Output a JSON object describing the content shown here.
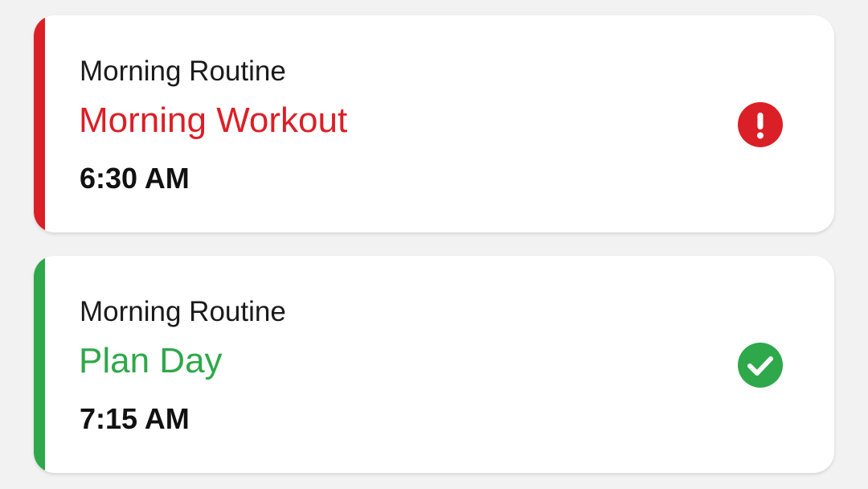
{
  "colors": {
    "overdue": "#db1f26",
    "done": "#2ea84a",
    "background": "#f2f2f2",
    "card": "#ffffff"
  },
  "tasks": [
    {
      "category": "Morning Routine",
      "title": "Morning Workout",
      "time": "6:30 AM",
      "status": "overdue",
      "status_icon": "alert-icon"
    },
    {
      "category": "Morning Routine",
      "title": "Plan Day",
      "time": "7:15 AM",
      "status": "done",
      "status_icon": "check-circle-icon"
    }
  ]
}
